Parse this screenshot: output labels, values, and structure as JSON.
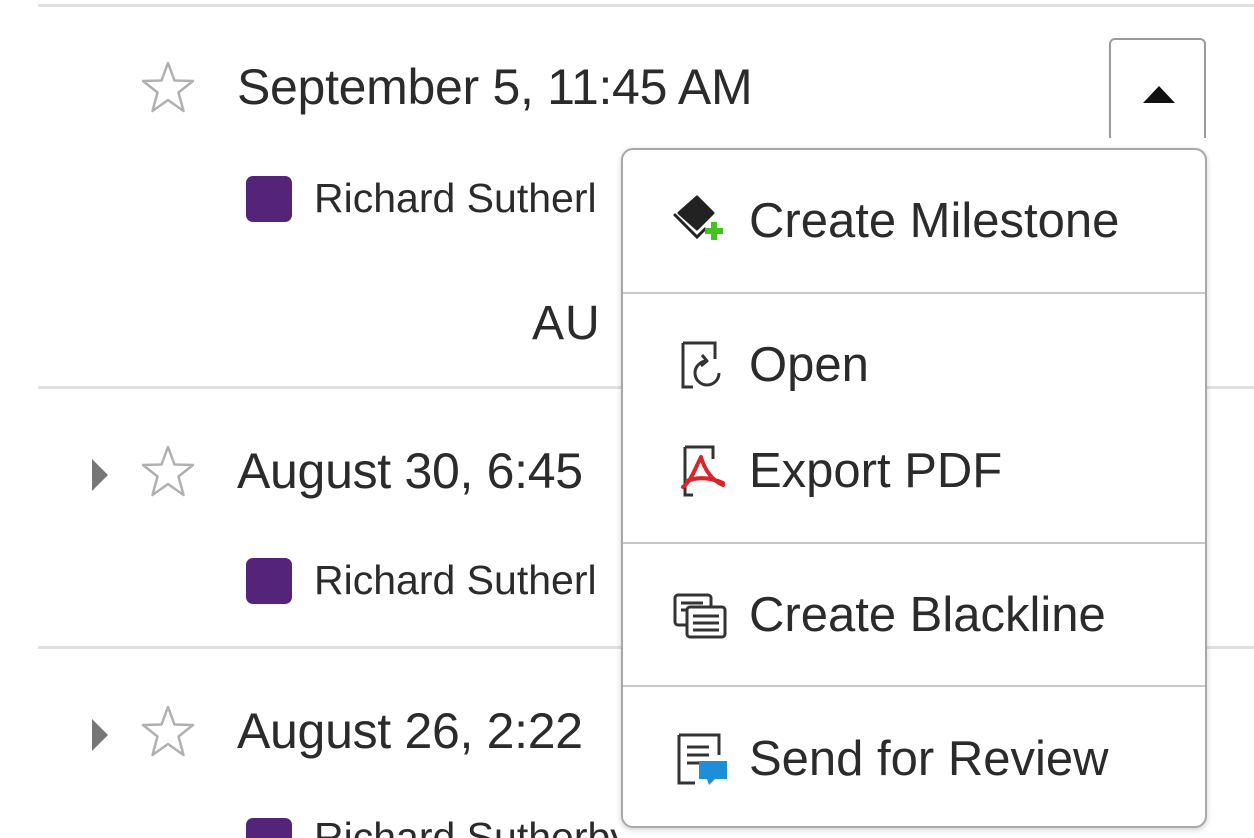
{
  "colors": {
    "author_swatch": "#53247a",
    "star_outline": "#b0b0b0",
    "caret": "#777777",
    "pdf_red": "#d9262b",
    "milestone_green": "#45c21e",
    "review_blue": "#1e8ed8"
  },
  "versions": [
    {
      "timestamp": "September 5, 11:45 AM",
      "author": "Richard Sutherl",
      "starred": false,
      "expanded": true
    },
    {
      "timestamp": "August 30, 6:45",
      "author": "Richard Sutherl",
      "starred": false,
      "expanded": false
    },
    {
      "timestamp": "August 26, 2:22",
      "author": "Richard Sutherby",
      "starred": false,
      "expanded": false
    }
  ],
  "group_header": "AU",
  "menu": {
    "items": [
      {
        "label": "Create Milestone",
        "icon": "create-milestone-icon"
      },
      {
        "label": "Open",
        "icon": "open-icon"
      },
      {
        "label": "Export PDF",
        "icon": "pdf-icon"
      },
      {
        "label": "Create Blackline",
        "icon": "blackline-icon"
      },
      {
        "label": "Send for Review",
        "icon": "send-review-icon"
      }
    ]
  }
}
